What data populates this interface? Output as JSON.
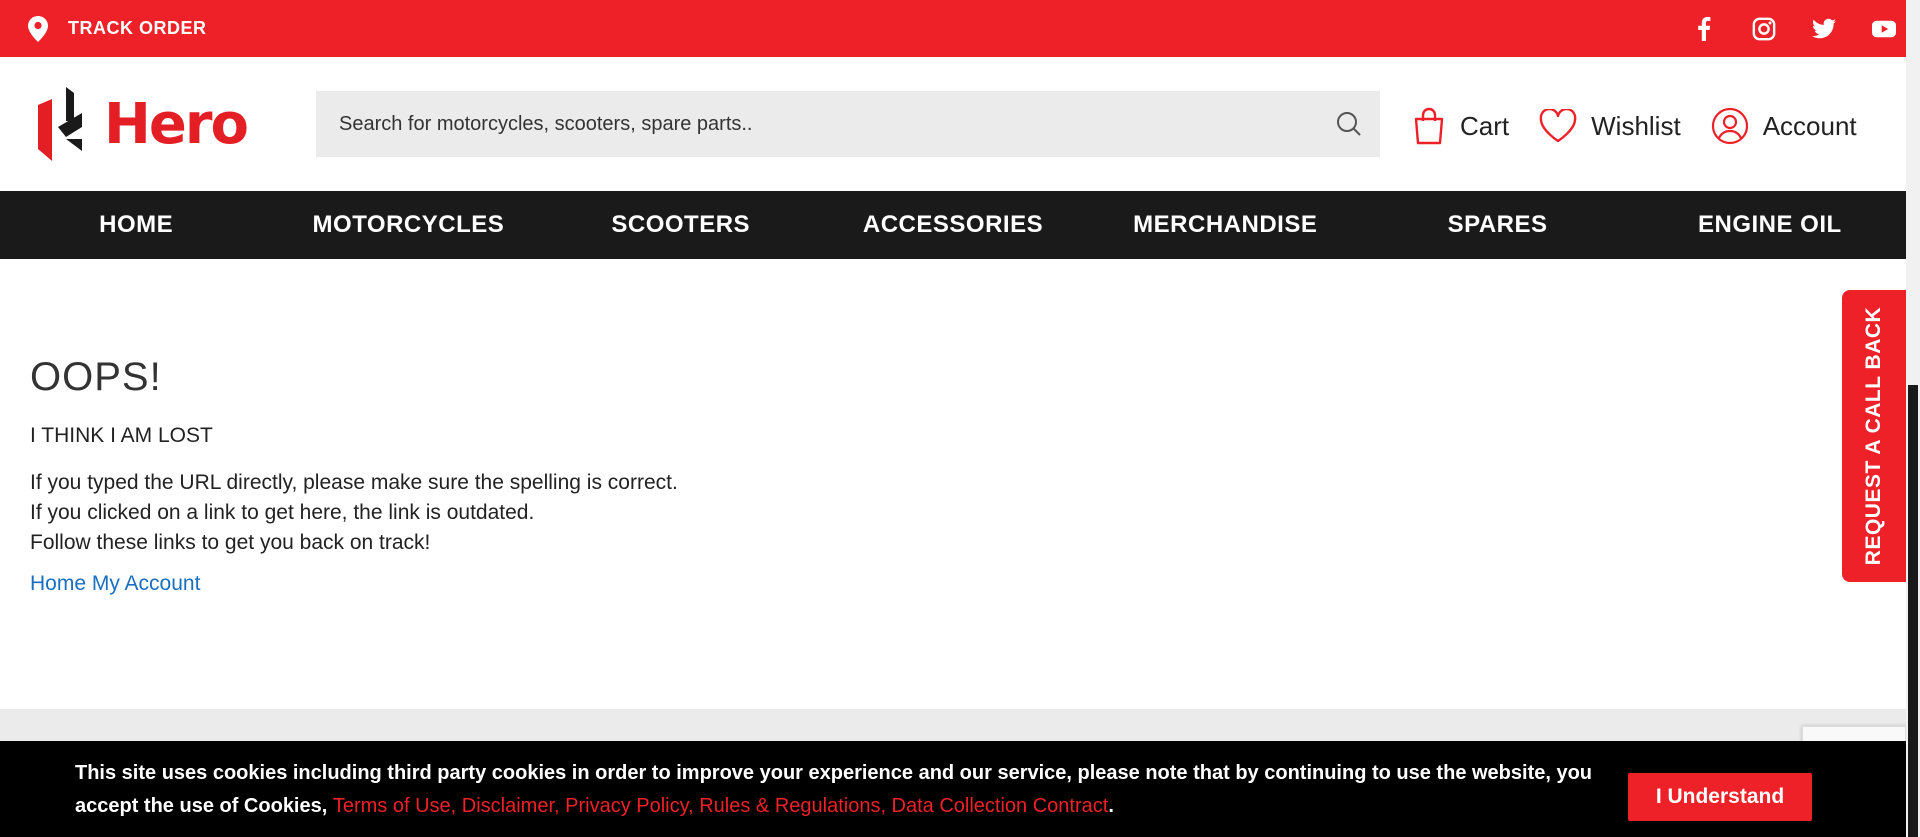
{
  "topbar": {
    "track_order": "TRACK ORDER",
    "social": [
      "facebook-icon",
      "instagram-icon",
      "twitter-icon",
      "youtube-icon"
    ]
  },
  "header": {
    "logo_text": "Hero",
    "search_placeholder": "Search for motorcycles, scooters, spare parts..",
    "cart": "Cart",
    "wishlist": "Wishlist",
    "account": "Account"
  },
  "nav": {
    "items": [
      "HOME",
      "MOTORCYCLES",
      "SCOOTERS",
      "ACCESSORIES",
      "MERCHANDISE",
      "SPARES",
      "ENGINE OIL"
    ]
  },
  "error": {
    "title": "OOPS!",
    "subtitle": "I THINK I AM LOST",
    "line1": "If you typed the URL directly, please make sure the spelling is correct.",
    "line2": "If you clicked on a link to get here, the link is outdated.",
    "line3": "Follow these links to get you back on track!",
    "link_home": "Home",
    "link_account": "My Account"
  },
  "callback": {
    "label": "REQUEST A CALL BACK"
  },
  "cookie": {
    "text": "This site uses cookies including third party cookies in order to improve your experience and our service, please note that by continuing to use the website, you accept the use of Cookies, ",
    "links": "Terms of Use, Disclaimer, Privacy Policy, Rules & Regulations, Data Collection Contract",
    "end": ".",
    "button": "I Understand"
  },
  "colors": {
    "brand_red": "#ee2028",
    "nav_bg": "#1a1a1a",
    "link_blue": "#1a6fc0"
  }
}
